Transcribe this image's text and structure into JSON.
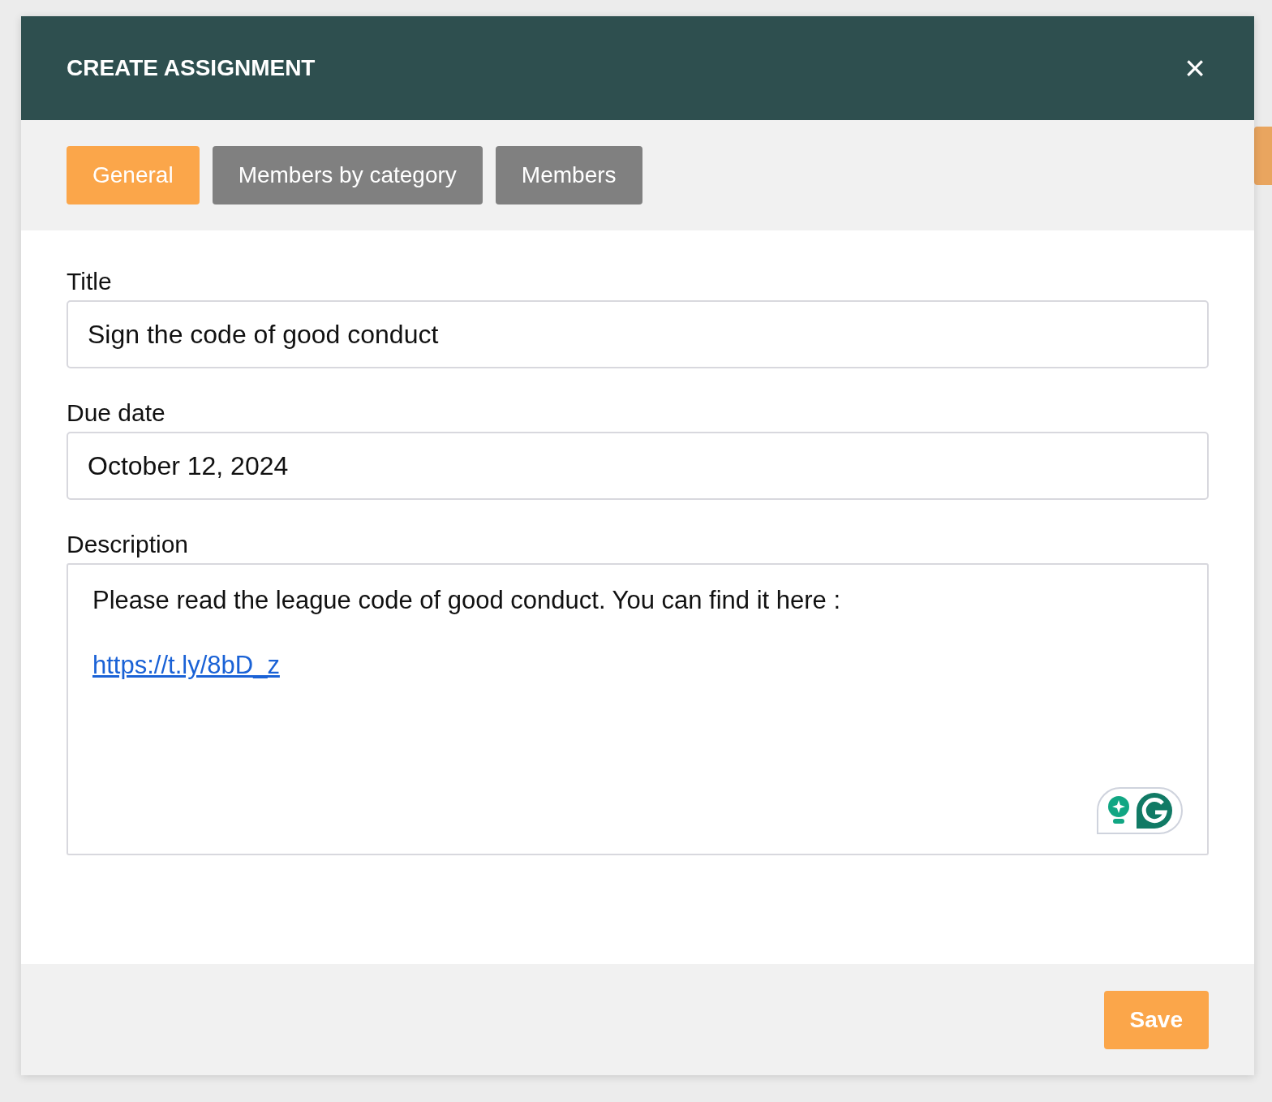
{
  "dialog": {
    "title": "CREATE ASSIGNMENT",
    "close": "×"
  },
  "tabs": [
    {
      "label": "General",
      "selected": true
    },
    {
      "label": "Members by category",
      "selected": false
    },
    {
      "label": "Members",
      "selected": false
    }
  ],
  "fields": [
    {
      "kind": "input",
      "label": "Title",
      "value": "Sign the code of good conduct"
    },
    {
      "kind": "input",
      "label": "Due date",
      "value": "October 12, 2024"
    },
    {
      "kind": "rich",
      "label": "Description",
      "text": "Please read the league code of good conduct. You can find it here :",
      "link": "https://t.ly/8bD_z"
    }
  ],
  "buttons": [
    "Save"
  ]
}
